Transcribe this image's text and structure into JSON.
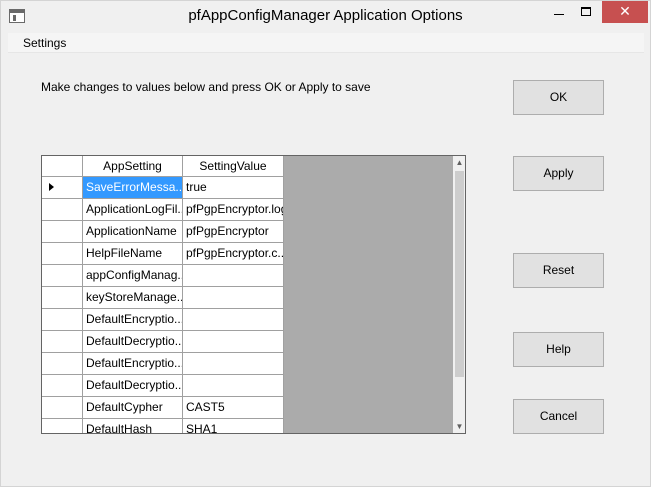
{
  "window": {
    "title": "pfAppConfigManager Application Options",
    "minimize_glyph": "",
    "maximize_glyph": "",
    "close_glyph": "✕"
  },
  "menu": {
    "items": [
      "Settings"
    ]
  },
  "instruction": "Make changes to values below and press OK or Apply to save",
  "buttons": {
    "ok": "OK",
    "apply": "Apply",
    "reset": "Reset",
    "help": "Help",
    "cancel": "Cancel"
  },
  "grid": {
    "columns": [
      "AppSetting",
      "SettingValue"
    ],
    "selected_row": 0,
    "rows": [
      {
        "key": "SaveErrorMessa...",
        "value": "true"
      },
      {
        "key": "ApplicationLogFil...",
        "value": "pfPgpEncryptor.log"
      },
      {
        "key": "ApplicationName",
        "value": "pfPgpEncryptor"
      },
      {
        "key": "HelpFileName",
        "value": "pfPgpEncryptor.c..."
      },
      {
        "key": "appConfigManag...",
        "value": ""
      },
      {
        "key": "keyStoreManage...",
        "value": ""
      },
      {
        "key": "DefaultEncryptio...",
        "value": ""
      },
      {
        "key": "DefaultDecryptio...",
        "value": ""
      },
      {
        "key": "DefaultEncryptio...",
        "value": ""
      },
      {
        "key": "DefaultDecryptio...",
        "value": ""
      },
      {
        "key": "DefaultCypher",
        "value": "CAST5"
      },
      {
        "key": "DefaultHash",
        "value": "SHA1"
      }
    ]
  },
  "scrollbar": {
    "up_glyph": "▲",
    "down_glyph": "▼"
  }
}
